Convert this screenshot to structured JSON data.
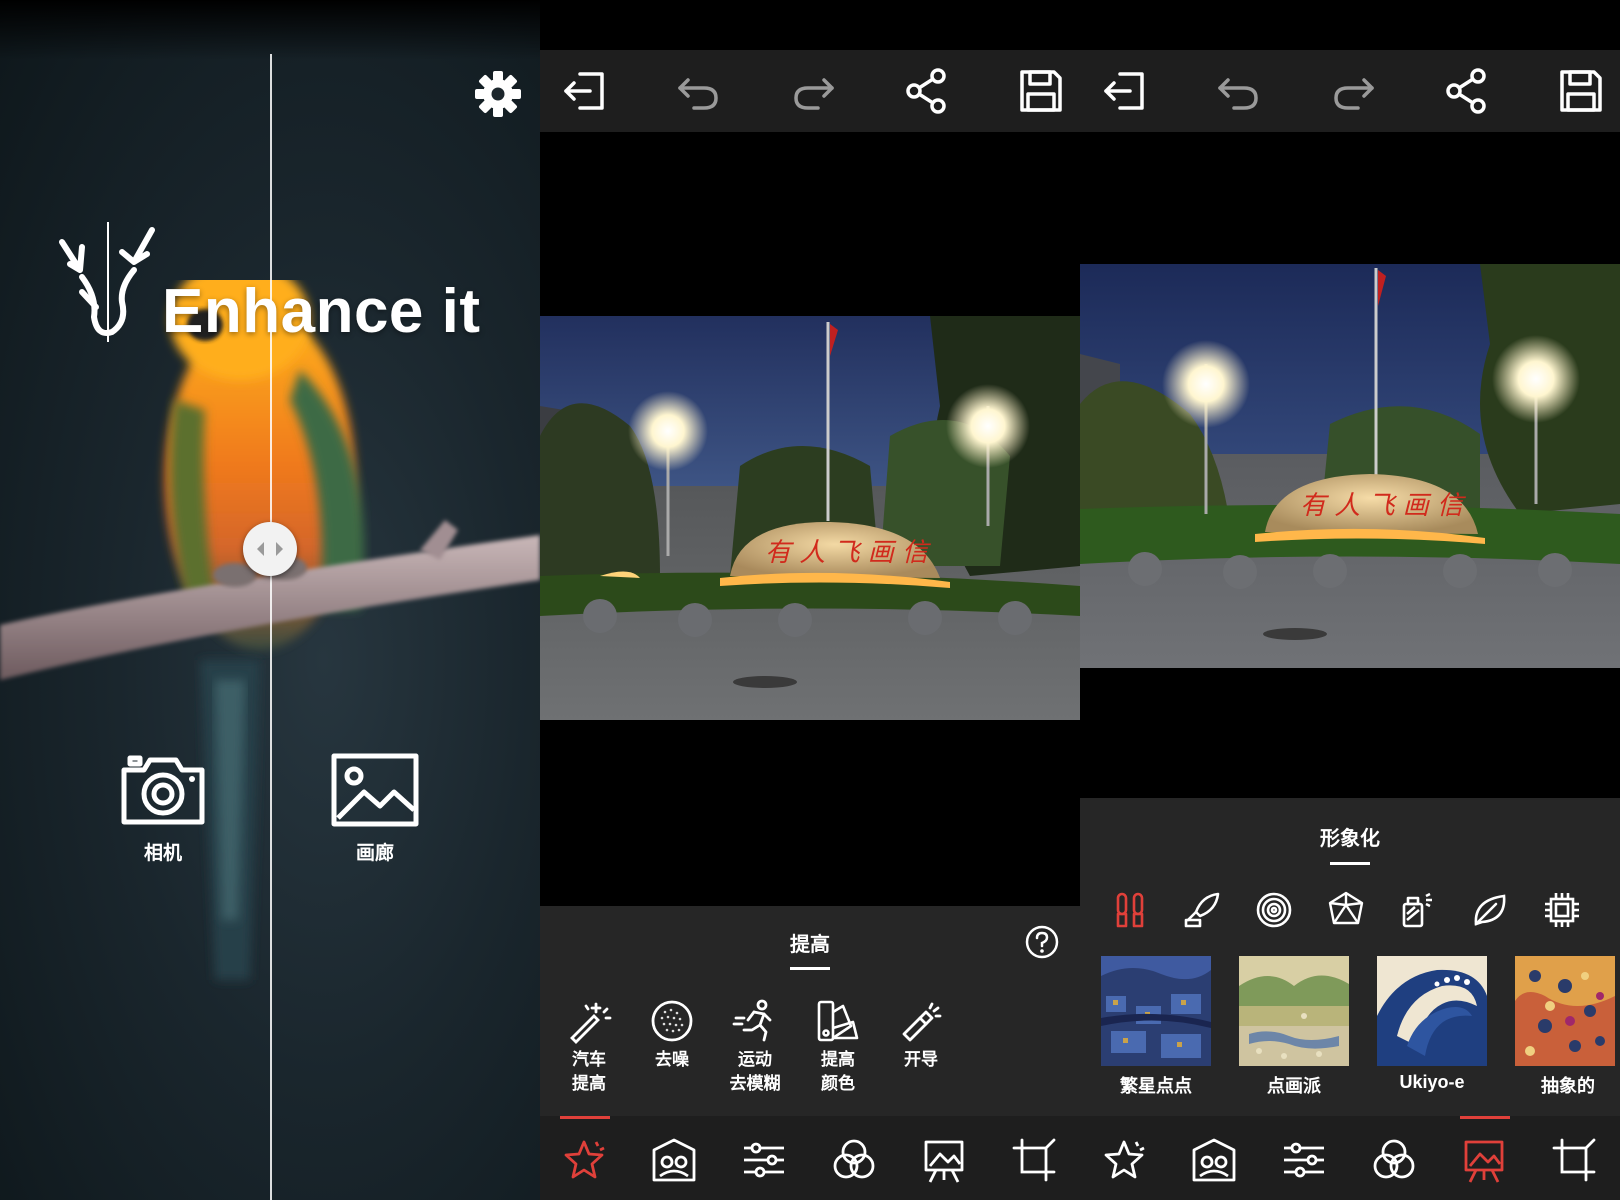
{
  "home": {
    "brand_title": "Enhance it",
    "camera_label": "相机",
    "gallery_label": "画廊",
    "icons": {
      "settings": "gear-icon",
      "camera": "camera-icon",
      "gallery": "gallery-icon",
      "compare_handle": "left-right-arrows-icon",
      "logo": "deer-antler-logo"
    }
  },
  "toolbar": {
    "icons": [
      "exit-icon",
      "undo-icon",
      "redo-icon",
      "share-icon",
      "save-icon"
    ]
  },
  "enhance_sheet": {
    "title": "提高",
    "help_icon": "help-circle-icon",
    "tools": [
      {
        "line1": "汽车",
        "line2": "提高",
        "icon": "magic-wand-icon"
      },
      {
        "line1": "去噪",
        "line2": "",
        "icon": "noise-circle-icon"
      },
      {
        "line1": "运动",
        "line2": "去模糊",
        "icon": "running-person-icon"
      },
      {
        "line1": "提高",
        "line2": "颜色",
        "icon": "color-swatch-icon"
      },
      {
        "line1": "开导",
        "line2": "",
        "icon": "flashlight-icon"
      }
    ]
  },
  "stylize_sheet": {
    "title": "形象化",
    "categories": [
      "paintbrushes-icon",
      "quill-icon",
      "swirl-circle-icon",
      "polyhedron-icon",
      "spray-can-icon",
      "leaf-icon",
      "chip-icon"
    ],
    "styles": [
      {
        "label": "繁星点点"
      },
      {
        "label": "点画派"
      },
      {
        "label": "Ukiyo-e"
      },
      {
        "label": "抽象的"
      }
    ]
  },
  "bottom_nav": {
    "items": [
      "enhance-star-icon",
      "portrait-icon",
      "sliders-icon",
      "color-circles-icon",
      "stylize-easel-icon",
      "crop-icon"
    ],
    "active_panel2": "enhance-star-icon",
    "active_panel3": "stylize-easel-icon"
  },
  "colors": {
    "accent": "#e0403a",
    "bar_bg": "#1e1e1e",
    "sheet_bg": "#262626"
  }
}
